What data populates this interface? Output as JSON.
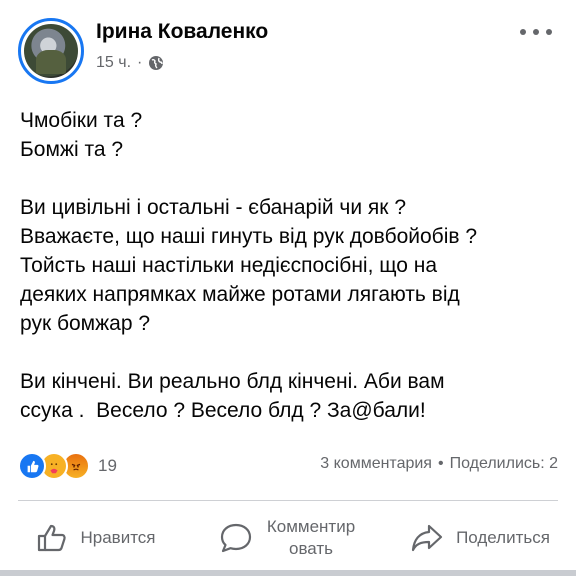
{
  "author": {
    "name": "Ірина Коваленко",
    "time": "15 ч.",
    "separator": "·",
    "privacy_icon": "globe-icon",
    "more_icon": "more-options-icon"
  },
  "post": {
    "paragraphs": [
      [
        "Чмобіки та ?",
        "Бомжі та ?"
      ],
      [
        "Ви цивільні і остальні - єбанарій чи як ?",
        "Вважаєте, що наші гинуть від рук довбойобів ?",
        "Тойсть наші настільки недієспосібні, що на",
        "деяких напрямках майже ротами лягають від",
        "рук бомжар ?"
      ],
      [
        "Ви кінчені. Ви реально блд кінчені. Аби вам",
        "ссука .  Весело ? Весело блд ? За@бали!"
      ]
    ]
  },
  "reactions": {
    "icons": [
      "like-icon",
      "care-icon",
      "angry-icon"
    ],
    "count": "19",
    "colors": {
      "like": "#1877f2",
      "care": "#f7b125",
      "angry": "#e9710f"
    }
  },
  "stats": {
    "comments": "3 комментария",
    "separator": "•",
    "shares": "Поделились: 2"
  },
  "actions": {
    "like": "Нравится",
    "comment": "Комментировать",
    "share": "Поделиться"
  },
  "colors": {
    "accent": "#1877f2",
    "muted": "#65676b",
    "text": "#050505"
  }
}
